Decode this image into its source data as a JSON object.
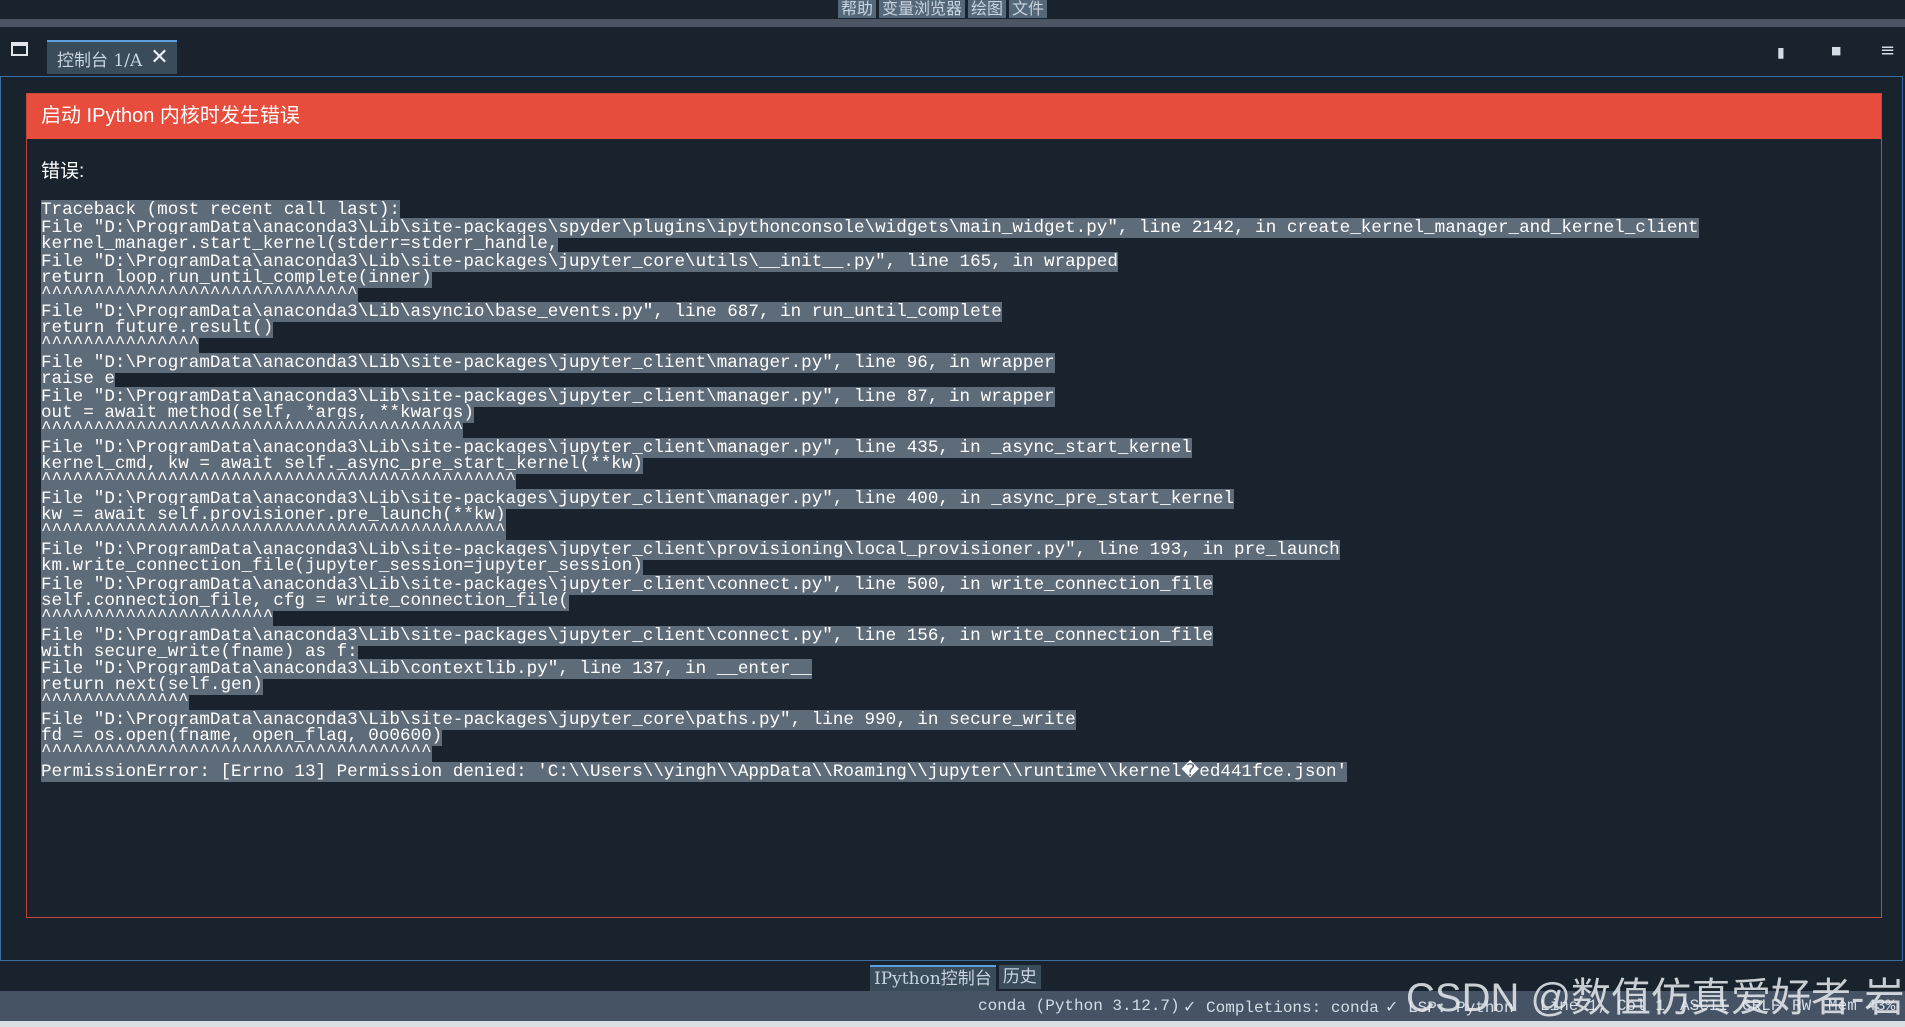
{
  "menu_tabs": [
    "帮助",
    "变量浏览器",
    "绘图",
    "文件"
  ],
  "console_tab": {
    "label": "控制台 1/A",
    "close": "✕"
  },
  "header_icons": {
    "copy": "▮",
    "stop": "■",
    "menu": "≡"
  },
  "error": {
    "title": "启动 IPython 内核时发生错误",
    "label": "错误:",
    "traceback": [
      "Traceback (most recent call last):",
      "File \"D:\\ProgramData\\anaconda3\\Lib\\site-packages\\spyder\\plugins\\ipythonconsole\\widgets\\main_widget.py\", line 2142, in create_kernel_manager_and_kernel_client",
      "kernel_manager.start_kernel(stderr=stderr_handle,",
      "File \"D:\\ProgramData\\anaconda3\\Lib\\site-packages\\jupyter_core\\utils\\__init__.py\", line 165, in wrapped",
      "return loop.run_until_complete(inner)",
      "^^^^^^^^^^^^^^^^^^^^^^^^^^^^^^",
      "File \"D:\\ProgramData\\anaconda3\\Lib\\asyncio\\base_events.py\", line 687, in run_until_complete",
      "return future.result()",
      "^^^^^^^^^^^^^^^",
      "File \"D:\\ProgramData\\anaconda3\\Lib\\site-packages\\jupyter_client\\manager.py\", line 96, in wrapper",
      "raise e",
      "File \"D:\\ProgramData\\anaconda3\\Lib\\site-packages\\jupyter_client\\manager.py\", line 87, in wrapper",
      "out = await method(self, *args, **kwargs)",
      "^^^^^^^^^^^^^^^^^^^^^^^^^^^^^^^^^^^^^^^^",
      "File \"D:\\ProgramData\\anaconda3\\Lib\\site-packages\\jupyter_client\\manager.py\", line 435, in _async_start_kernel",
      "kernel_cmd, kw = await self._async_pre_start_kernel(**kw)",
      "^^^^^^^^^^^^^^^^^^^^^^^^^^^^^^^^^^^^^^^^^^^^^",
      "File \"D:\\ProgramData\\anaconda3\\Lib\\site-packages\\jupyter_client\\manager.py\", line 400, in _async_pre_start_kernel",
      "kw = await self.provisioner.pre_launch(**kw)",
      "^^^^^^^^^^^^^^^^^^^^^^^^^^^^^^^^^^^^^^^^^^^^",
      "File \"D:\\ProgramData\\anaconda3\\Lib\\site-packages\\jupyter_client\\provisioning\\local_provisioner.py\", line 193, in pre_launch",
      "km.write_connection_file(jupyter_session=jupyter_session)",
      "File \"D:\\ProgramData\\anaconda3\\Lib\\site-packages\\jupyter_client\\connect.py\", line 500, in write_connection_file",
      "self.connection_file, cfg = write_connection_file(",
      "^^^^^^^^^^^^^^^^^^^^^^",
      "File \"D:\\ProgramData\\anaconda3\\Lib\\site-packages\\jupyter_client\\connect.py\", line 156, in write_connection_file",
      "with secure_write(fname) as f:",
      "File \"D:\\ProgramData\\anaconda3\\Lib\\contextlib.py\", line 137, in __enter__",
      "return next(self.gen)",
      "^^^^^^^^^^^^^^",
      "File \"D:\\ProgramData\\anaconda3\\Lib\\site-packages\\jupyter_core\\paths.py\", line 990, in secure_write",
      "fd = os.open(fname, open_flag, 0o0600)",
      "^^^^^^^^^^^^^^^^^^^^^^^^^^^^^^^^^^^^^",
      "PermissionError: [Errno 13] Permission denied: 'C:\\\\Users\\\\yingh\\\\AppData\\\\Roaming\\\\jupyter\\\\runtime\\\\kernel�ed441fce.json'"
    ]
  },
  "bottom_tabs": [
    "IPython控制台",
    "历史"
  ],
  "status": {
    "env": "conda (Python 3.12.7)",
    "completions": "✓ Completions: conda",
    "lsp": "✓ LSP: Python",
    "line": "Line 1, Col 1",
    "encoding": "ASCII",
    "eol": "CRLF",
    "rw": "RW",
    "mem": "Mem 43%"
  },
  "watermark": "CSDN @数值仿真爱好者-岩土"
}
